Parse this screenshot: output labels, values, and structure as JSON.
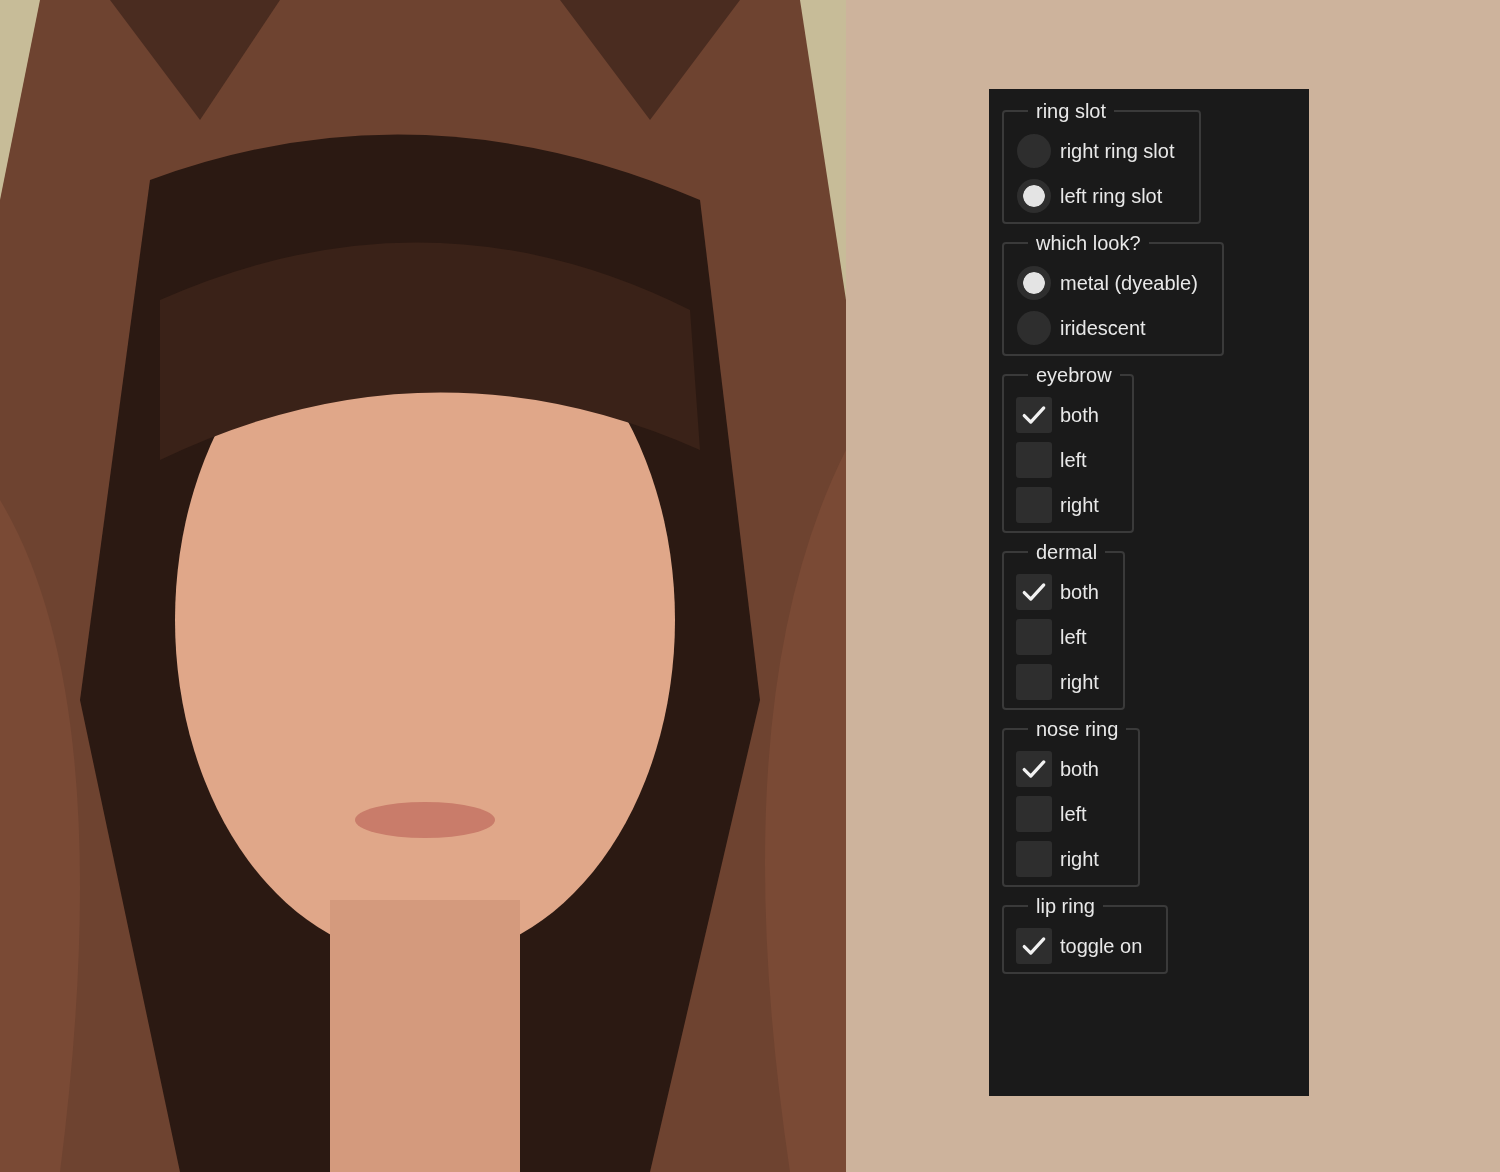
{
  "groups": [
    {
      "title": "ring slot",
      "kind": "radio",
      "options": [
        {
          "label": "right ring slot",
          "selected": false
        },
        {
          "label": "left ring slot",
          "selected": true
        }
      ]
    },
    {
      "title": "which look?",
      "kind": "radio",
      "options": [
        {
          "label": "metal (dyeable)",
          "selected": true
        },
        {
          "label": "iridescent",
          "selected": false
        }
      ]
    },
    {
      "title": "eyebrow",
      "kind": "checkbox",
      "options": [
        {
          "label": "both",
          "checked": true
        },
        {
          "label": "left",
          "checked": false
        },
        {
          "label": "right",
          "checked": false
        }
      ]
    },
    {
      "title": "dermal",
      "kind": "checkbox",
      "options": [
        {
          "label": "both",
          "checked": true
        },
        {
          "label": "left",
          "checked": false
        },
        {
          "label": "right",
          "checked": false
        }
      ]
    },
    {
      "title": "nose ring",
      "kind": "checkbox",
      "options": [
        {
          "label": "both",
          "checked": true
        },
        {
          "label": "left",
          "checked": false
        },
        {
          "label": "right",
          "checked": false
        }
      ]
    },
    {
      "title": "lip ring",
      "kind": "checkbox",
      "options": [
        {
          "label": "toggle on",
          "checked": true
        }
      ]
    }
  ]
}
